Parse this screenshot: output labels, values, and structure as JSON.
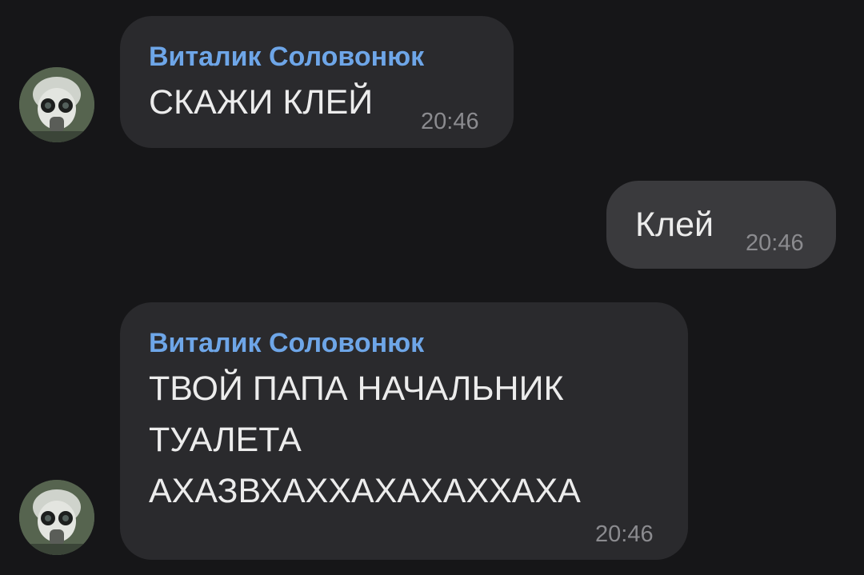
{
  "messages": [
    {
      "direction": "incoming",
      "sender": "Виталик Соловонюк",
      "lines": [
        "СКАЖИ КЛЕЙ"
      ],
      "time": "20:46"
    },
    {
      "direction": "outgoing",
      "lines": [
        "Клей"
      ],
      "time": "20:46"
    },
    {
      "direction": "incoming",
      "sender": "Виталик Соловонюк",
      "lines": [
        "ТВОЙ ПАПА НАЧАЛЬНИК",
        "ТУАЛЕТА",
        "АХАЗВХАХХАХАХАХХАХА"
      ],
      "time": "20:46"
    }
  ],
  "colors": {
    "background": "#161618",
    "incoming_bubble": "#2a2a2d",
    "outgoing_bubble": "#3a3a3d",
    "sender_name": "#6ea6e8",
    "message_text": "#ececec",
    "timestamp": "#8b8b8f"
  },
  "icons": {
    "avatar": "gas-mask-avatar-icon"
  }
}
